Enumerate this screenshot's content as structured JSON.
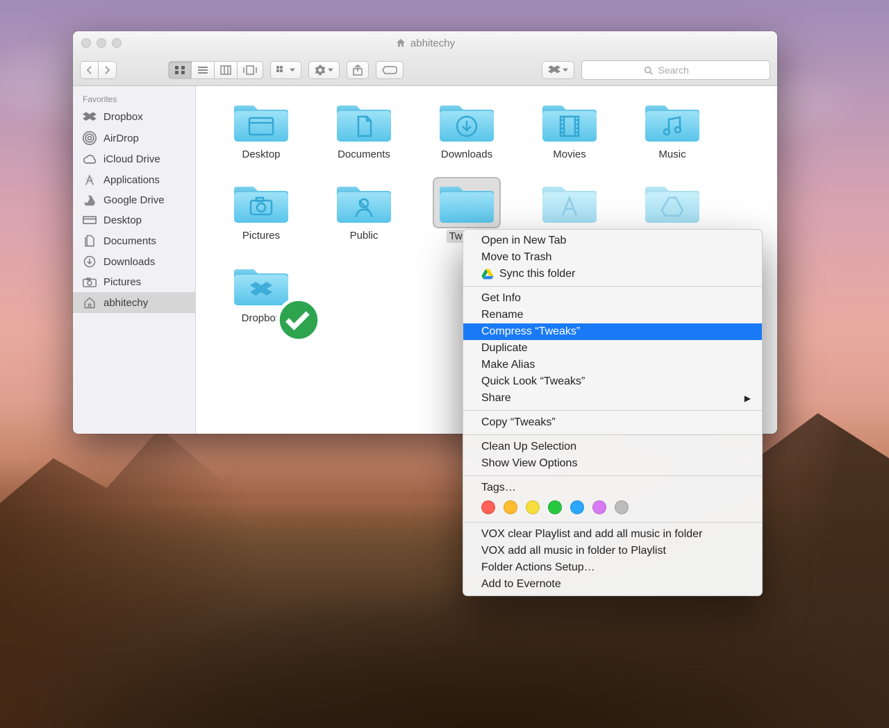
{
  "window": {
    "title": "abhitechy",
    "inactive": true
  },
  "toolbar": {
    "search_placeholder": "Search"
  },
  "sidebar": {
    "header": "Favorites",
    "items": [
      {
        "icon": "dropbox",
        "label": "Dropbox"
      },
      {
        "icon": "airdrop",
        "label": "AirDrop"
      },
      {
        "icon": "icloud",
        "label": "iCloud Drive"
      },
      {
        "icon": "apps",
        "label": "Applications"
      },
      {
        "icon": "gdrive",
        "label": "Google Drive"
      },
      {
        "icon": "desktop",
        "label": "Desktop"
      },
      {
        "icon": "docs",
        "label": "Documents"
      },
      {
        "icon": "downloads",
        "label": "Downloads"
      },
      {
        "icon": "pictures",
        "label": "Pictures"
      },
      {
        "icon": "home",
        "label": "abhitechy",
        "active": true
      }
    ]
  },
  "folders": [
    {
      "name": "Desktop",
      "glyph": "window"
    },
    {
      "name": "Documents",
      "glyph": "doc"
    },
    {
      "name": "Downloads",
      "glyph": "download"
    },
    {
      "name": "Movies",
      "glyph": "film"
    },
    {
      "name": "Music",
      "glyph": "music"
    },
    {
      "name": "Pictures",
      "glyph": "camera"
    },
    {
      "name": "Public",
      "glyph": "public"
    },
    {
      "name": "Tweaks",
      "glyph": "",
      "selected": true
    },
    {
      "name": "",
      "glyph": "apps",
      "faded": true
    },
    {
      "name": "",
      "glyph": "gdrive",
      "faded": true
    },
    {
      "name": "Dropbox",
      "glyph": "dropbox",
      "badge": "check"
    }
  ],
  "context_menu": {
    "groups": [
      [
        {
          "label": "Open in New Tab"
        },
        {
          "label": "Move to Trash"
        },
        {
          "label": "Sync this folder",
          "icon": "gdrive-color"
        }
      ],
      [
        {
          "label": "Get Info"
        },
        {
          "label": "Rename"
        },
        {
          "label": "Compress “Tweaks”",
          "highlight": true
        },
        {
          "label": "Duplicate"
        },
        {
          "label": "Make Alias"
        },
        {
          "label": "Quick Look “Tweaks”"
        },
        {
          "label": "Share",
          "submenu": true
        }
      ],
      [
        {
          "label": "Copy “Tweaks”"
        }
      ],
      [
        {
          "label": "Clean Up Selection"
        },
        {
          "label": "Show View Options"
        }
      ],
      [
        {
          "label": "Tags…"
        },
        {
          "tags_row": true,
          "colors": [
            "#fe6057",
            "#febc2e",
            "#f6de3c",
            "#28c840",
            "#2da7ff",
            "#d77af3",
            "#bcbcbc"
          ]
        }
      ],
      [
        {
          "label": "VOX clear Playlist and add all music in folder"
        },
        {
          "label": "VOX add all music in folder to Playlist"
        },
        {
          "label": "Folder Actions Setup…"
        },
        {
          "label": "Add to Evernote"
        }
      ]
    ]
  }
}
